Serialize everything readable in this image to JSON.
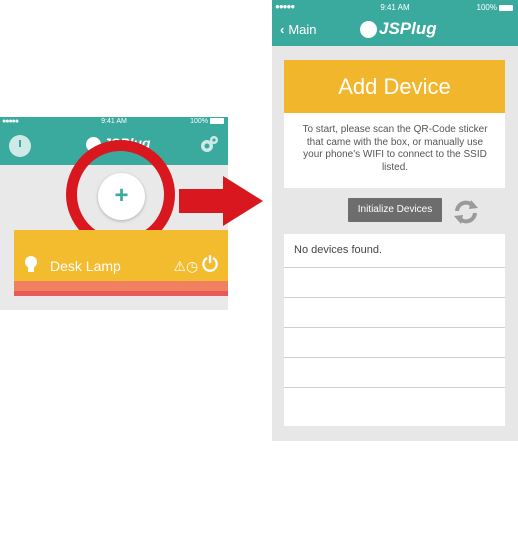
{
  "left_screen": {
    "status": {
      "signal": "●●●●●",
      "time": "9:41 AM",
      "battery": "100%"
    },
    "nav": {
      "logo": "JSPlug"
    },
    "add_button_glyph": "+",
    "device": {
      "name": "Desk Lamp",
      "status_icons": "⚠◷"
    }
  },
  "right_screen": {
    "status": {
      "signal": "●●●●●",
      "time": "9:41 AM",
      "battery": "100%"
    },
    "nav": {
      "back_label": "Main",
      "back_chevron": "‹",
      "logo": "JSPlug"
    },
    "add_device": {
      "title": "Add Device",
      "instructions": "To start, please scan the QR-Code sticker that came with the box, or manually use your phone's WIFI to connect to the SSID listed."
    },
    "initialize_button": "Initialize Devices",
    "device_list": {
      "rows": [
        "No devices found.",
        "",
        "",
        "",
        "",
        ""
      ]
    }
  },
  "colors": {
    "teal": "#3aaa9e",
    "amber": "#f2b62c",
    "red": "#d9171f",
    "button_gray": "#6d6d6d"
  }
}
